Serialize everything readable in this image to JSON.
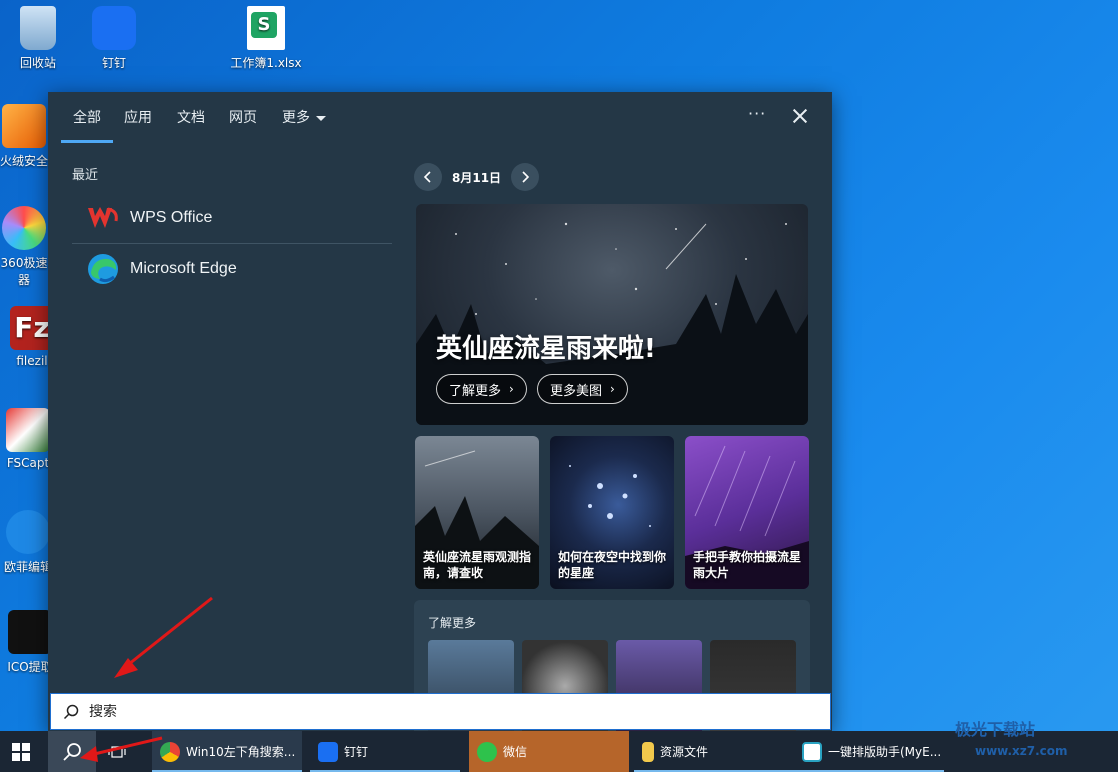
{
  "desktop": {
    "icons": [
      {
        "label": "回收站"
      },
      {
        "label": "钉钉"
      },
      {
        "label": "工作簿1.xlsx"
      },
      {
        "label": "火绒安全"
      },
      {
        "label": "360极速"
      },
      {
        "label": "器"
      },
      {
        "label": "filezil"
      },
      {
        "label": "FSCapt"
      },
      {
        "label": "欧菲编辑"
      },
      {
        "label": "ICO提取"
      }
    ]
  },
  "search_panel": {
    "tabs": [
      {
        "label": "全部",
        "active": true
      },
      {
        "label": "应用"
      },
      {
        "label": "文档"
      },
      {
        "label": "网页"
      },
      {
        "label": "更多"
      }
    ],
    "more_options_icon": "ellipsis-icon",
    "recent_title": "最近",
    "recent_apps": [
      {
        "name": "WPS Office",
        "icon": "wps-icon"
      },
      {
        "name": "Microsoft Edge",
        "icon": "edge-icon"
      }
    ],
    "date": "8月11日",
    "hero": {
      "title": "英仙座流星雨来啦!",
      "learn_more": "了解更多",
      "more_images": "更多美图"
    },
    "cards": [
      {
        "caption": "英仙座流星雨观测指南，请查收"
      },
      {
        "caption": "如何在夜空中找到你的星座"
      },
      {
        "caption": "手把手教你拍摄流星雨大片"
      }
    ],
    "learn_more_section": {
      "title": "了解更多"
    }
  },
  "search_box": {
    "placeholder": "搜索"
  },
  "taskbar": {
    "apps": [
      {
        "label": "Win10左下角搜索...",
        "icon": "chrome-icon"
      },
      {
        "label": "钉钉",
        "icon": "dingtalk-icon"
      },
      {
        "label": "微信",
        "icon": "wechat-icon"
      },
      {
        "label": "资源文件",
        "icon": "folder-icon"
      },
      {
        "label": "一键排版助手(MyE...",
        "icon": "myeditor-icon"
      }
    ]
  },
  "watermark": {
    "title": "极光下载站",
    "url": "www.xz7.com"
  },
  "colors": {
    "accent": "#4ea8f5",
    "panel": "#243746",
    "active_app": "#b6652a"
  }
}
